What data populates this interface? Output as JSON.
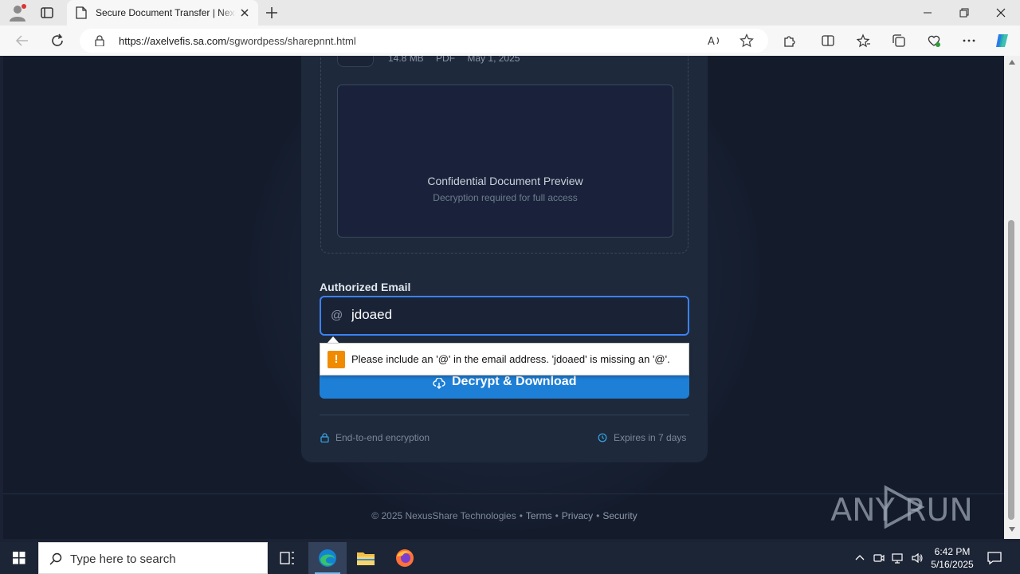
{
  "browser": {
    "tab": {
      "title": "Secure Document Transfer | Nexus"
    },
    "url": {
      "host": "https://axelvefis.sa.com",
      "path": "/sgwordpess/sharepnnt.html"
    }
  },
  "page": {
    "file": {
      "size": "14.8 MB",
      "type": "PDF",
      "date": "May 1, 2025"
    },
    "preview": {
      "title": "Confidential Document Preview",
      "subtitle": "Decryption required for full access"
    },
    "email": {
      "label": "Authorized Email",
      "value": "jdoaed"
    },
    "validation": {
      "message": "Please include an '@' in the email address. 'jdoaed' is missing an '@'."
    },
    "decrypt_button": {
      "label": "Decrypt & Download"
    },
    "security": {
      "encryption": "End-to-end encryption",
      "expires": "Expires in 7 days"
    },
    "footer": {
      "copyright": "© 2025 NexusShare Technologies",
      "links": [
        "Terms",
        "Privacy",
        "Security"
      ]
    },
    "watermark": "ANY RUN"
  },
  "taskbar": {
    "search_placeholder": "Type here to search",
    "time": "6:42 PM",
    "date": "5/16/2025"
  },
  "colors": {
    "page_bg": "#141c2c",
    "card_bg": "#1e293b",
    "accent_blue": "#1d7fd6",
    "focus_border": "#3b82f6",
    "warning": "#f08a00"
  }
}
